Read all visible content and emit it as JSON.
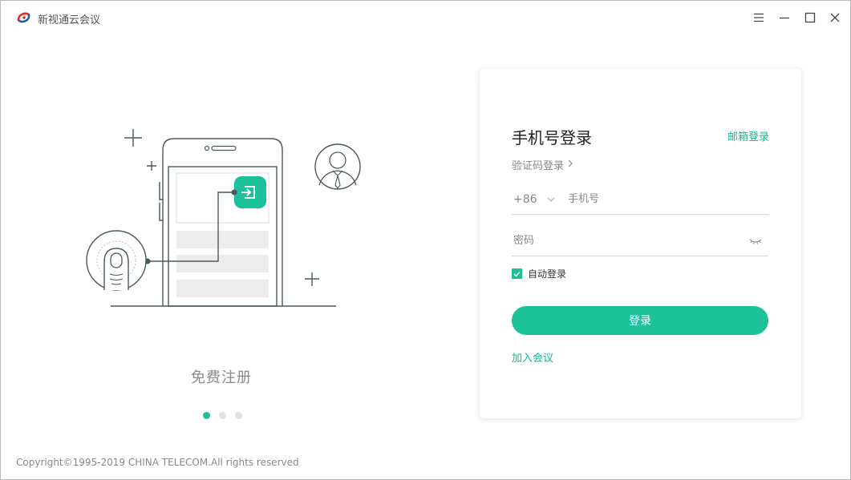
{
  "app": {
    "title": "新视通云会议",
    "logo_icon": "china-telecom-logo-icon"
  },
  "window_controls": {
    "menu_icon": "hamburger-menu-icon",
    "minimize_icon": "minimize-icon",
    "maximize_icon": "maximize-icon",
    "close_icon": "close-icon"
  },
  "carousel": {
    "caption": "免费注册",
    "slide_count": 3,
    "active_index": 0,
    "illustration_icons": [
      "phone-illustration-icon",
      "fingerprint-icon",
      "user-avatar-icon",
      "login-arrow-icon"
    ]
  },
  "login": {
    "title": "手机号登录",
    "email_login_link": "邮箱登录",
    "code_login_link": "验证码登录",
    "country_code": "+86",
    "phone_placeholder": "手机号",
    "phone_value": "",
    "password_placeholder": "密码",
    "password_value": "",
    "auto_login_label": "自动登录",
    "auto_login_checked": true,
    "login_button": "登录",
    "join_meeting_link": "加入会议"
  },
  "footer": {
    "copyright": "Copyright©1995-2019 CHINA TELECOM.All rights reserved"
  },
  "colors": {
    "accent": "#1ec29a",
    "link": "#16b892",
    "illustration_stroke": "#4a5a55"
  }
}
